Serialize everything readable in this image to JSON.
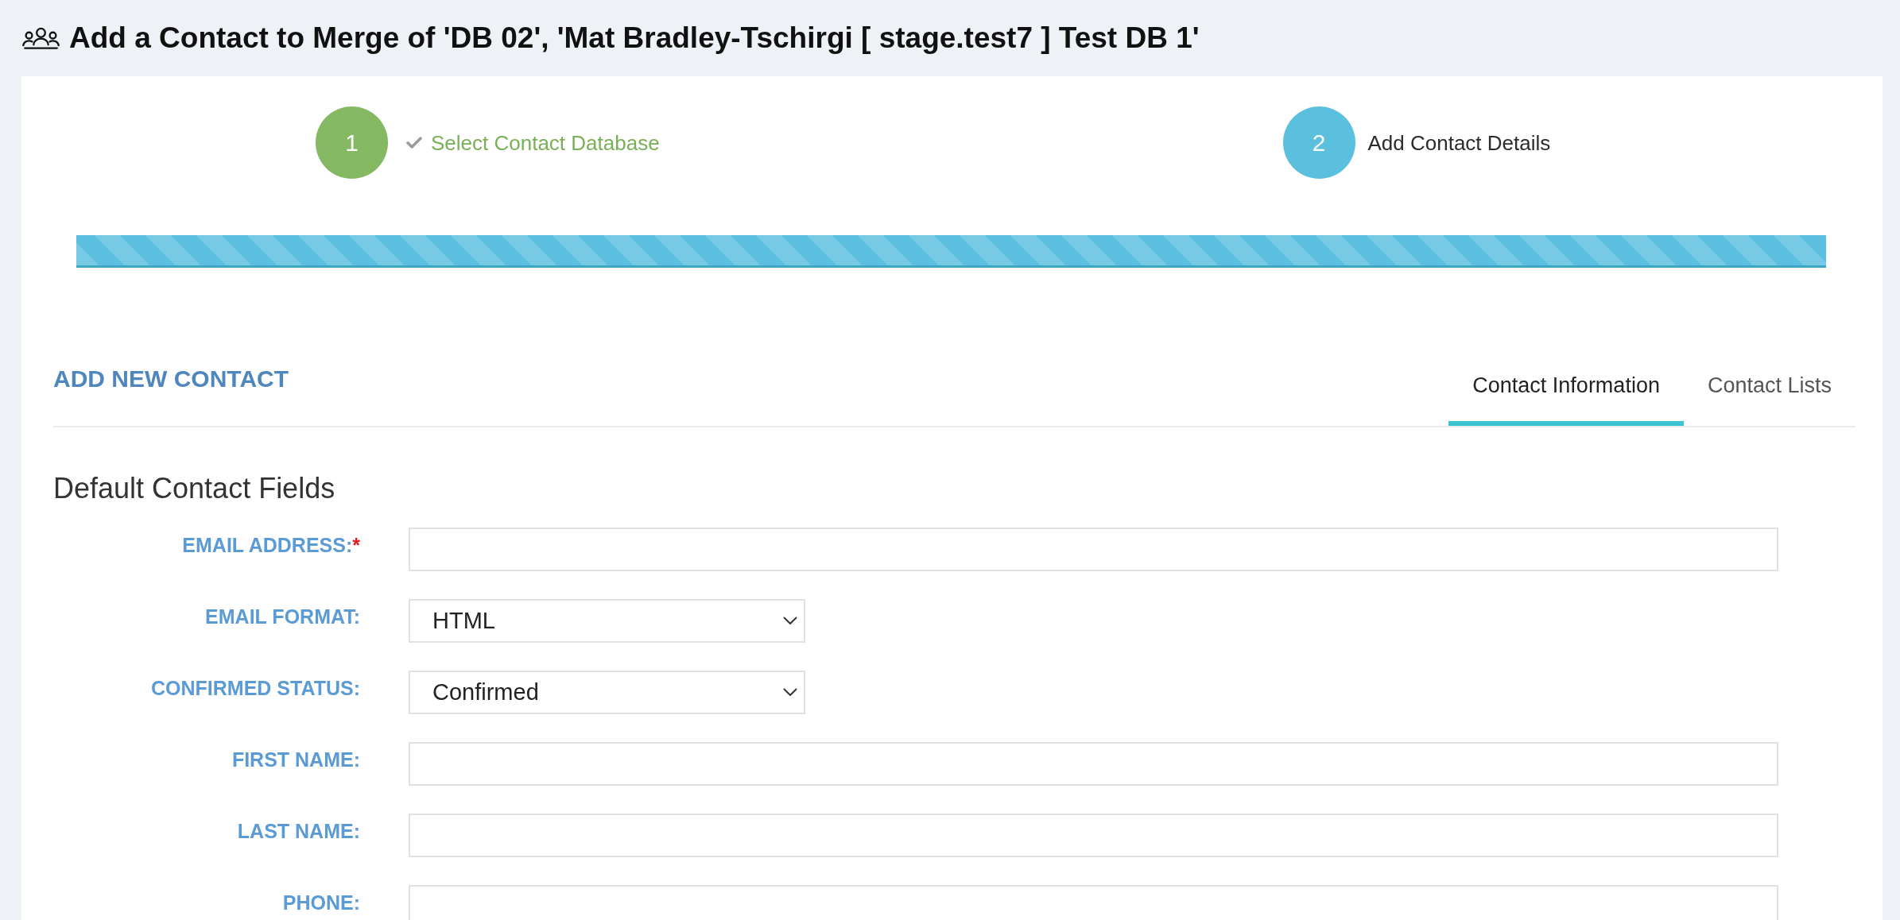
{
  "page": {
    "title": "Add a Contact to Merge of 'DB 02', 'Mat Bradley-Tschirgi [ stage.test7 ] Test DB 1'"
  },
  "steps": [
    {
      "number": "1",
      "label": "Select Contact Database",
      "completed": true,
      "current": false
    },
    {
      "number": "2",
      "label": "Add Contact Details",
      "completed": false,
      "current": true
    }
  ],
  "progress": {
    "level": 1
  },
  "section": {
    "heading": "ADD NEW CONTACT",
    "tabs": [
      {
        "label": "Contact Information",
        "selected": true
      },
      {
        "label": "Contact Lists",
        "selected": false
      }
    ]
  },
  "form": {
    "title": "Default Contact Fields",
    "fields": [
      {
        "label": "EMAIL ADDRESS:",
        "required_mark": "*",
        "kind": "text"
      },
      {
        "label": "EMAIL FORMAT:",
        "kind": "select",
        "value": "HTML"
      },
      {
        "label": "CONFIRMED STATUS:",
        "kind": "select",
        "value": "Confirmed"
      },
      {
        "label": "FIRST NAME:",
        "kind": "text"
      },
      {
        "label": "LAST NAME:",
        "kind": "text"
      },
      {
        "label": "PHONE:",
        "kind": "text"
      }
    ]
  }
}
